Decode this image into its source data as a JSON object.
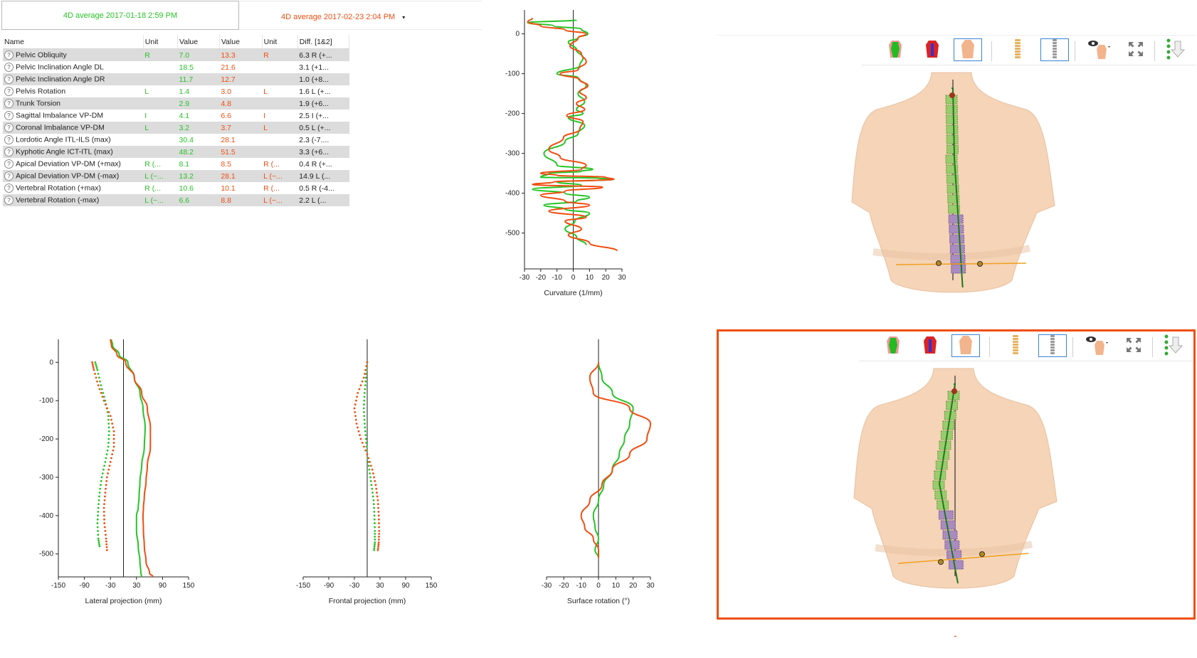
{
  "header": {
    "date1_label": "4D average 2017-01-18 2:59 PM",
    "date2_label": "4D average 2017-02-23 2:04 PM",
    "date2_dropdown_arrow": "▾"
  },
  "colors": {
    "series1": "#27c427",
    "series2": "#f04e12",
    "selection": "#f04e12",
    "active_tool": "#3a83d6"
  },
  "table": {
    "columns": [
      "Name",
      "Unit",
      "Value",
      "Value",
      "Unit",
      "Diff. [1&2]"
    ],
    "rows": [
      {
        "name": "Pelvic Obliquity",
        "unit1": "R",
        "value1": "7.0",
        "value2": "13.3",
        "unit2": "R",
        "diff": "6.3  R (+..."
      },
      {
        "name": "Pelvic Inclination Angle DL",
        "unit1": "",
        "value1": "18.5",
        "value2": "21.6",
        "unit2": "",
        "diff": "3.1  (+1..."
      },
      {
        "name": "Pelvic Inclination Angle DR",
        "unit1": "",
        "value1": "11.7",
        "value2": "12.7",
        "unit2": "",
        "diff": "1.0  (+8..."
      },
      {
        "name": "Pelvis Rotation",
        "unit1": "L",
        "value1": "1.4",
        "value2": "3.0",
        "unit2": "L",
        "diff": "1.6  L (+..."
      },
      {
        "name": "Trunk Torsion",
        "unit1": "",
        "value1": "2.9",
        "value2": "4.8",
        "unit2": "",
        "diff": "1.9  (+6..."
      },
      {
        "name": "Sagittal Imbalance VP-DM",
        "unit1": "I",
        "value1": "4.1",
        "value2": "6.6",
        "unit2": "I",
        "diff": "2.5  I (+..."
      },
      {
        "name": "Coronal Imbalance VP-DM",
        "unit1": "L",
        "value1": "3.2",
        "value2": "3.7",
        "unit2": "L",
        "diff": "0.5  L (+..."
      },
      {
        "name": "Lordotic Angle ITL-ILS (max)",
        "unit1": "",
        "value1": "30.4",
        "value2": "28.1",
        "unit2": "",
        "diff": "2.3  (-7...."
      },
      {
        "name": "Kyphotic Angle ICT-ITL (max)",
        "unit1": "",
        "value1": "48.2",
        "value2": "51.5",
        "unit2": "",
        "diff": "3.3  (+6..."
      },
      {
        "name": "Apical Deviation VP-DM (+max)",
        "unit1": "R  (...",
        "value1": "8.1",
        "value2": "8.5",
        "unit2": "R  (...",
        "diff": "0.4  R (+..."
      },
      {
        "name": "Apical Deviation VP-DM (-max)",
        "unit1": "L  (~...",
        "value1": "13.2",
        "value2": "28.1",
        "unit2": "L  (~...",
        "diff": "14.9  L (..."
      },
      {
        "name": "Vertebral Rotation (+max)",
        "unit1": "R  (...",
        "value1": "10.6",
        "value2": "10.1",
        "unit2": "R  (...",
        "diff": "0.5  R (-4..."
      },
      {
        "name": "Vertebral Rotation (-max)",
        "unit1": "L  (~...",
        "value1": "6.6",
        "value2": "8.8",
        "unit2": "L  (~...",
        "diff": "2.2  L (..."
      }
    ],
    "help_icon": "?"
  },
  "charts": {
    "curvature": {
      "xlabel": "Curvature (1/mm)",
      "xticks": [
        "-30",
        "-20",
        "-10",
        "0",
        "10",
        "20",
        "30"
      ],
      "yticks": [
        "0",
        "-100",
        "-200",
        "-300",
        "-400",
        "-500"
      ]
    },
    "lateral": {
      "xlabel": "Lateral projection (mm)",
      "xticks": [
        "-150",
        "-90",
        "-30",
        "30",
        "90",
        "150"
      ],
      "yticks": [
        "0",
        "-100",
        "-200",
        "-300",
        "-400",
        "-500"
      ]
    },
    "frontal": {
      "xlabel": "Frontal projection (mm)",
      "xticks": [
        "-150",
        "-90",
        "-30",
        "30",
        "90",
        "150"
      ]
    },
    "rotation": {
      "xlabel": "Surface rotation (°)",
      "xticks": [
        "-30",
        "-20",
        "-10",
        "0",
        "10",
        "20",
        "30"
      ]
    }
  },
  "chart_data": [
    {
      "type": "line",
      "xlabel": "Curvature (1/mm)",
      "ylabel": "",
      "xlim": [
        -30,
        30
      ],
      "ylim": [
        -590,
        60
      ],
      "series": [
        {
          "x": [
            2,
            -28,
            -12,
            5,
            9,
            3,
            -3,
            2,
            6,
            4,
            -10,
            3,
            8,
            3,
            7,
            2,
            6,
            -3,
            7,
            3,
            -5,
            -18,
            -10,
            12,
            5,
            -15,
            -20,
            15,
            25,
            -10,
            5,
            -25,
            -5,
            10,
            2,
            -18,
            -5,
            10,
            1,
            -5,
            2,
            8
          ],
          "y": [
            35,
            28,
            20,
            12,
            0,
            -10,
            -20,
            -40,
            -60,
            -80,
            -100,
            -110,
            -130,
            -150,
            -170,
            -190,
            -200,
            -210,
            -230,
            -250,
            -270,
            -300,
            -330,
            -340,
            -345,
            -350,
            -360,
            -362,
            -365,
            -372,
            -380,
            -390,
            -400,
            -410,
            -420,
            -430,
            -440,
            -450,
            -470,
            -490,
            -510,
            -530
          ]
        },
        {
          "x": [
            -25,
            -28,
            -20,
            -5,
            8,
            3,
            -2,
            5,
            8,
            3,
            -8,
            4,
            9,
            4,
            8,
            2,
            7,
            -4,
            6,
            4,
            -6,
            -15,
            -8,
            8,
            5,
            -20,
            -10,
            20,
            25,
            -12,
            -25,
            18,
            -5,
            -20,
            -5,
            10,
            -15,
            8,
            -5,
            5,
            -3,
            10,
            27
          ],
          "y": [
            40,
            30,
            20,
            10,
            0,
            -10,
            -30,
            -50,
            -70,
            -90,
            -100,
            -115,
            -130,
            -145,
            -160,
            -175,
            -190,
            -205,
            -220,
            -240,
            -260,
            -290,
            -310,
            -330,
            -340,
            -350,
            -355,
            -360,
            -365,
            -372,
            -378,
            -385,
            -395,
            -405,
            -420,
            -430,
            -445,
            -460,
            -470,
            -490,
            -505,
            -525,
            -545
          ]
        }
      ]
    },
    {
      "type": "line",
      "xlabel": "Lateral projection (mm)",
      "ylabel": "",
      "xlim": [
        -150,
        150
      ],
      "ylim": [
        -560,
        60
      ],
      "series": [
        {
          "x": [
            -28,
            -25,
            -10,
            10,
            25,
            38,
            45,
            50,
            48,
            42,
            38,
            36,
            34,
            30,
            30,
            34,
            38,
            40,
            42
          ],
          "y": [
            60,
            45,
            20,
            0,
            -40,
            -80,
            -120,
            -170,
            -220,
            -270,
            -310,
            -350,
            -380,
            -400,
            -440,
            -480,
            -520,
            -550,
            -560
          ]
        },
        {
          "x": [
            -30,
            -28,
            -15,
            5,
            25,
            42,
            55,
            62,
            62,
            55,
            52,
            48,
            46,
            45,
            46,
            48,
            52,
            60,
            68
          ],
          "y": [
            60,
            45,
            20,
            0,
            -40,
            -80,
            -120,
            -170,
            -220,
            -270,
            -310,
            -350,
            -380,
            -400,
            -440,
            -480,
            -520,
            -550,
            -560
          ]
        },
        {
          "x": [
            -65,
            -60,
            -52,
            -42,
            -35,
            -33,
            -35,
            -42,
            -50,
            -55,
            -58,
            -60,
            -58,
            -55
          ],
          "y": [
            0,
            -20,
            -60,
            -100,
            -140,
            -180,
            -220,
            -260,
            -300,
            -340,
            -380,
            -420,
            -460,
            -480
          ]
        },
        {
          "x": [
            -72,
            -68,
            -58,
            -45,
            -30,
            -22,
            -22,
            -30,
            -38,
            -42,
            -45,
            -44,
            -40,
            -38
          ],
          "y": [
            0,
            -20,
            -60,
            -100,
            -140,
            -180,
            -220,
            -260,
            -300,
            -340,
            -380,
            -420,
            -460,
            -490
          ]
        }
      ]
    },
    {
      "type": "line",
      "xlabel": "Frontal projection (mm)",
      "ylabel": "",
      "xlim": [
        -150,
        150
      ],
      "ylim": [
        -560,
        60
      ],
      "series": [
        {
          "x": [
            0,
            -3,
            -6,
            -8,
            -6,
            -3,
            0,
            5,
            10,
            15,
            17,
            18,
            18,
            16
          ],
          "y": [
            0,
            -40,
            -80,
            -120,
            -160,
            -200,
            -240,
            -280,
            -320,
            -360,
            -400,
            -440,
            -470,
            -490
          ]
        },
        {
          "x": [
            0,
            -8,
            -22,
            -30,
            -25,
            -15,
            0,
            12,
            20,
            25,
            27,
            28,
            27,
            25
          ],
          "y": [
            0,
            -40,
            -80,
            -120,
            -160,
            -200,
            -240,
            -280,
            -320,
            -360,
            -400,
            -440,
            -470,
            -490
          ]
        }
      ]
    },
    {
      "type": "line",
      "xlabel": "Surface rotation (°)",
      "ylabel": "",
      "xlim": [
        -30,
        30
      ],
      "ylim": [
        -560,
        60
      ],
      "series": [
        {
          "x": [
            0,
            2,
            8,
            20,
            18,
            15,
            12,
            8,
            3,
            0,
            -3,
            -2,
            0,
            -2,
            0
          ],
          "y": [
            0,
            -40,
            -80,
            -120,
            -160,
            -200,
            -240,
            -280,
            -320,
            -360,
            -400,
            -430,
            -460,
            -490,
            -510
          ]
        },
        {
          "x": [
            0,
            -5,
            -3,
            18,
            30,
            28,
            18,
            8,
            2,
            -5,
            -10,
            -8,
            -3,
            0,
            0
          ],
          "y": [
            0,
            -40,
            -80,
            -120,
            -160,
            -200,
            -240,
            -280,
            -320,
            -360,
            -400,
            -430,
            -460,
            -490,
            -510
          ]
        }
      ]
    }
  ],
  "viewers": {
    "toolbar_icons": [
      "torso-green-icon",
      "torso-red-icon",
      "torso-skin-icon",
      "spine-color-icon",
      "spine-gray-icon",
      "eye-person-icon",
      "fullscreen-icon",
      "download-arrow-icon"
    ],
    "bottom_selected_marker": "-"
  }
}
